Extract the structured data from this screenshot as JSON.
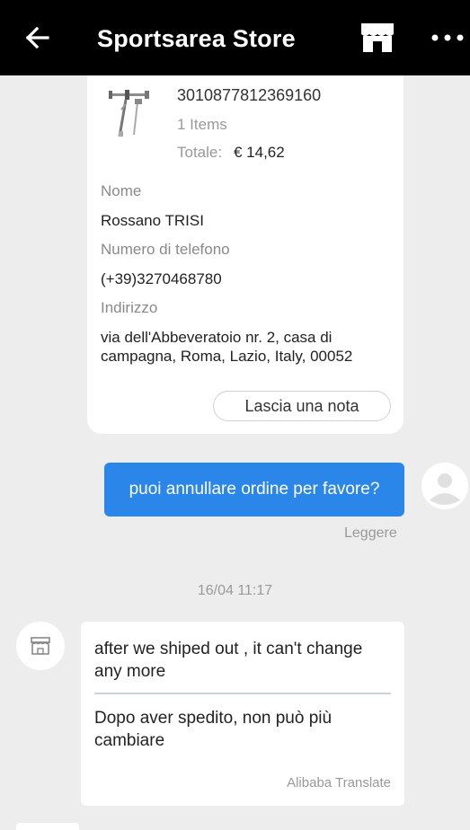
{
  "header": {
    "title": "Sportsarea Store",
    "back_icon": "arrow-left-icon",
    "store_icon": "storefront-icon",
    "more_icon": "more-horizontal-icon"
  },
  "order": {
    "id": "3010877812369160",
    "items": "1 Items",
    "total_label": "Totale:",
    "total_value": "€ 14,62",
    "name_label": "Nome",
    "name_value": "Rossano TRISI",
    "phone_label": "Numero di telefono",
    "phone_value": "(+39)3270468780",
    "address_label": "Indirizzo",
    "address_value": "via dell'Abbeveratoio nr. 2, casa di campagna, Roma, Lazio, Italy, 00052",
    "note_button": "Lascia una nota"
  },
  "messages": {
    "outgoing_text": "puoi annullare ordine per favore?",
    "read_status": "Leggere",
    "timestamp": "16/04 11:17",
    "incoming_original": "after we shiped out , it  can't change any more",
    "incoming_translated": "Dopo aver spedito, non può più cambiare",
    "translate_credit": "Alibaba Translate"
  },
  "colors": {
    "header_bg": "#000000",
    "background": "#ededed",
    "outgoing_bubble": "#2a86e8"
  }
}
